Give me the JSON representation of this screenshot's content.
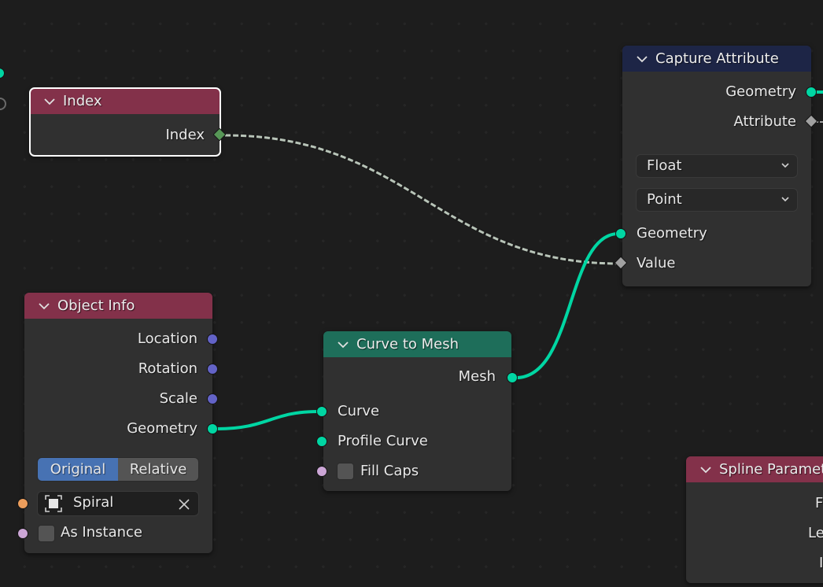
{
  "editor": "Geometry Node Editor",
  "colors": {
    "geometry_socket": "#00d6a3",
    "vector_socket": "#6363c7",
    "field_socket_green": "#579757",
    "field_socket_grey": "#a1a1a1",
    "object_socket": "#ed9e5c",
    "boolean_socket": "#cca6d6",
    "input_header": "#83314a",
    "attribute_header": "#1d2546",
    "geometry_header": "#1e6e5a",
    "selected_outline": "#ffffff",
    "active_toggle": "#4772b3"
  },
  "nodes": {
    "index": {
      "title": "Index",
      "selected": true,
      "outputs": [
        {
          "label": "Index",
          "socket": "field-diamond"
        }
      ]
    },
    "capture_attribute": {
      "title": "Capture Attribute",
      "outputs": [
        {
          "label": "Geometry",
          "socket": "geometry"
        },
        {
          "label": "Attribute",
          "socket": "field-diamond"
        }
      ],
      "data_type": "Float",
      "domain": "Point",
      "inputs": [
        {
          "label": "Geometry",
          "socket": "geometry"
        },
        {
          "label": "Value",
          "socket": "field-diamond"
        }
      ]
    },
    "object_info": {
      "title": "Object Info",
      "outputs": [
        {
          "label": "Location",
          "socket": "vector"
        },
        {
          "label": "Rotation",
          "socket": "vector"
        },
        {
          "label": "Scale",
          "socket": "vector"
        },
        {
          "label": "Geometry",
          "socket": "geometry"
        }
      ],
      "transform_space": {
        "options": [
          "Original",
          "Relative"
        ],
        "selected": "Original"
      },
      "object": {
        "value": "Spiral",
        "icon": "object-icon",
        "clear_icon": "x-icon"
      },
      "as_instance": {
        "label": "As Instance",
        "checked": false
      }
    },
    "curve_to_mesh": {
      "title": "Curve to Mesh",
      "outputs": [
        {
          "label": "Mesh",
          "socket": "geometry"
        }
      ],
      "inputs": [
        {
          "label": "Curve",
          "socket": "geometry"
        },
        {
          "label": "Profile Curve",
          "socket": "geometry"
        }
      ],
      "fill_caps": {
        "label": "Fill Caps",
        "checked": false
      }
    },
    "spline_parameter": {
      "title": "Spline Parameter",
      "outputs_partial": [
        "F",
        "Le",
        "I"
      ]
    }
  },
  "links": [
    {
      "from": "index.Index",
      "to": "capture_attribute.Value",
      "style": "dashed-field"
    },
    {
      "from": "object_info.Geometry",
      "to": "curve_to_mesh.Curve",
      "style": "geometry"
    },
    {
      "from": "curve_to_mesh.Mesh",
      "to": "capture_attribute.Geometry",
      "style": "geometry"
    }
  ]
}
